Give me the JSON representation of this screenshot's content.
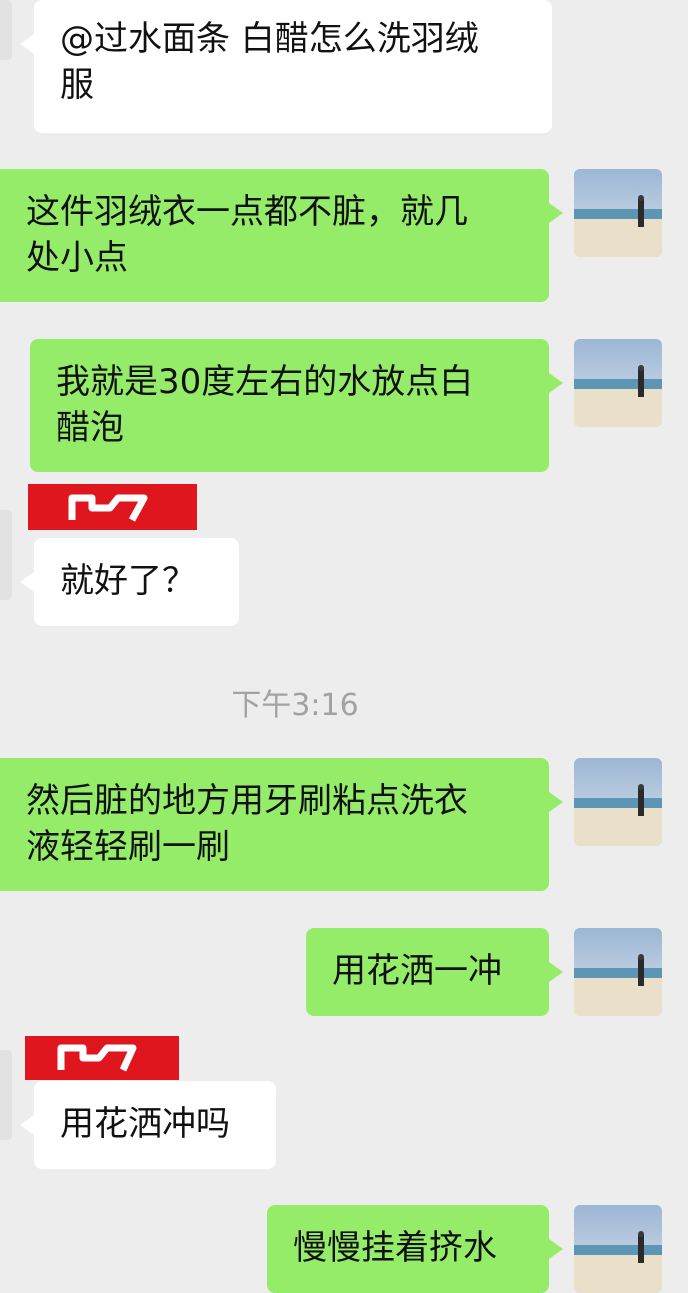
{
  "messages": [
    {
      "side": "in",
      "text": "@过水面条 白醋怎么洗羽绒\n服"
    },
    {
      "side": "out",
      "text": "这件羽绒衣一点都不脏，就几\n处小点"
    },
    {
      "side": "out",
      "text": "我就是30度左右的水放点白\n醋泡"
    },
    {
      "side": "in",
      "text": "就好了？"
    },
    {
      "side": "out",
      "text": "然后脏的地方用牙刷粘点洗衣\n液轻轻刷一刷"
    },
    {
      "side": "out",
      "text": "用花洒一冲"
    },
    {
      "side": "in",
      "text": "用花洒冲吗"
    },
    {
      "side": "out",
      "text": "慢慢挂着挤水"
    }
  ],
  "timestamp": "下午3:16",
  "icons": {
    "avatar": "beach-photo-avatar-icon",
    "redaction": "redacted-name-icon"
  },
  "colors": {
    "background": "#ededed",
    "outgoing_bubble": "#95ec69",
    "incoming_bubble": "#ffffff",
    "redaction": "#e0161e"
  }
}
